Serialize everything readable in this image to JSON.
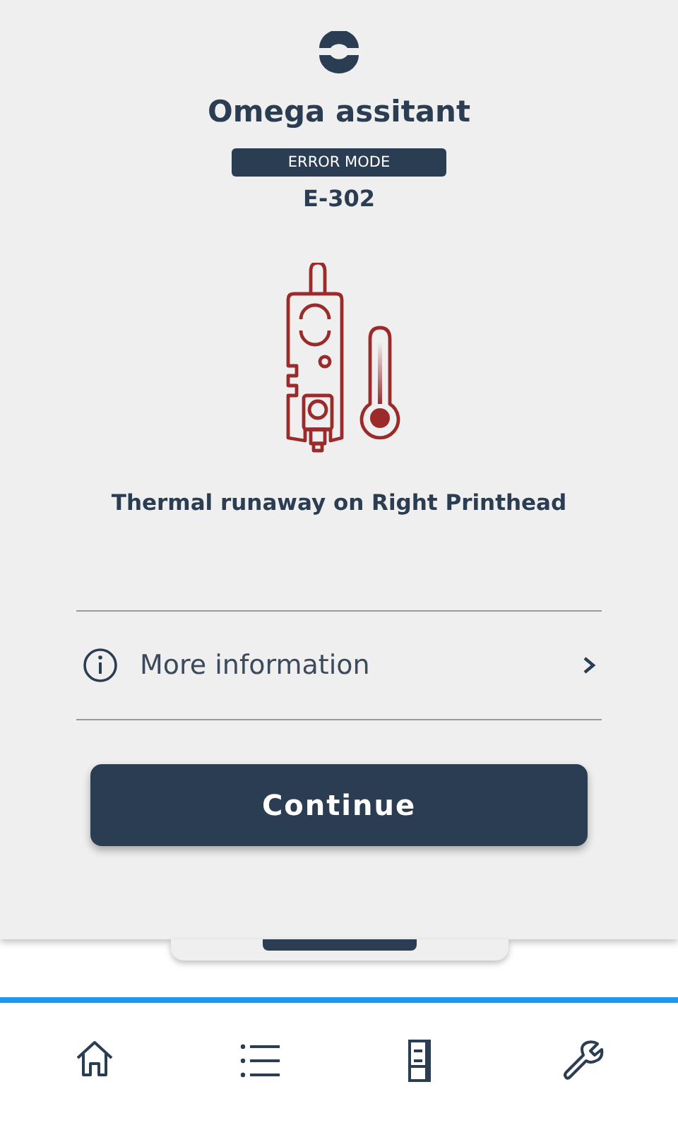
{
  "header": {
    "title": "Omega assitant",
    "mode_badge": "ERROR MODE",
    "error_code": "E-302"
  },
  "error": {
    "message": "Thermal runaway on Right Printhead"
  },
  "more_info": {
    "label": "More information"
  },
  "primary_button": {
    "label": "Continue"
  },
  "nav": [
    {
      "kind": "home"
    },
    {
      "kind": "list"
    },
    {
      "kind": "cabinet"
    },
    {
      "kind": "wrench"
    }
  ]
}
